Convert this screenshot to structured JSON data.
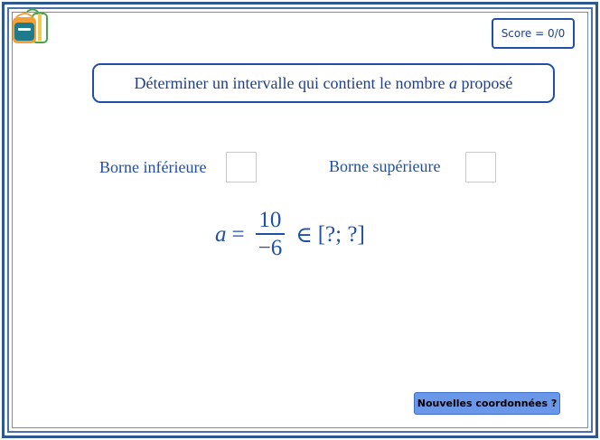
{
  "score": {
    "label": "Score = 0/0"
  },
  "instruction": {
    "before_var": "Déterminer un intervalle qui contient le nombre ",
    "var": "a",
    "after_var": " proposé"
  },
  "fields": {
    "lower_label": "Borne inférieure",
    "upper_label": "Borne supérieure",
    "lower_value": "",
    "upper_value": ""
  },
  "formula": {
    "var": "a",
    "equals": "=",
    "numerator": "10",
    "denominator": "−6",
    "member": "∈",
    "interval": "[?; ?]"
  },
  "button": {
    "new_coords": "Nouvelles coordonnées ?"
  },
  "colors": {
    "frame": "#2d5a8e",
    "text": "#1f4fa6",
    "button": "#6a97e8"
  },
  "icons": {
    "logo": "backpack-icon"
  }
}
